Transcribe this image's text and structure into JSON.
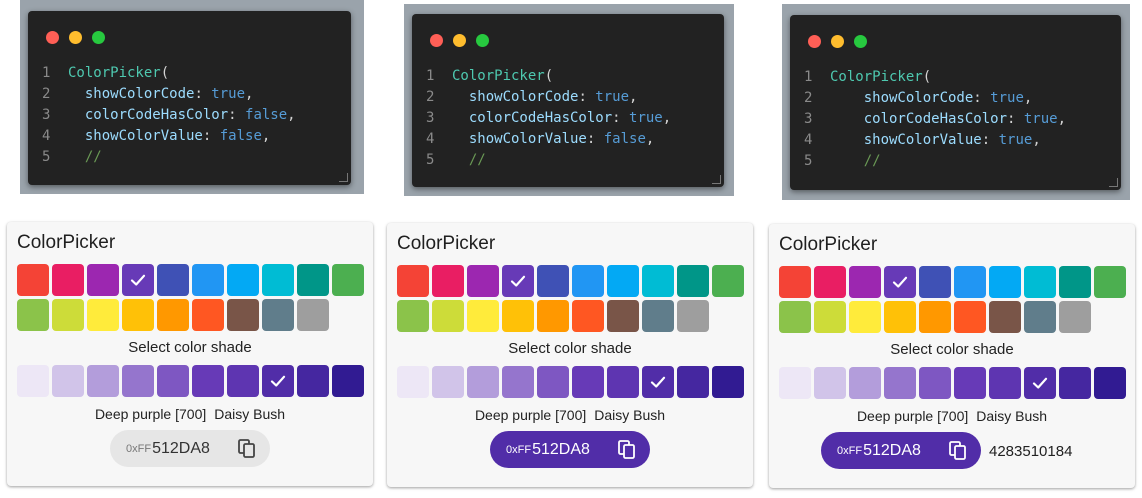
{
  "editors": [
    {
      "lines": [
        [
          "1",
          [
            [
              "cls",
              "ColorPicker"
            ],
            [
              "punct",
              "("
            ]
          ]
        ],
        [
          "2",
          [
            [
              "punct",
              "  "
            ],
            [
              "prop",
              "showColorCode"
            ],
            [
              "punct",
              ": "
            ],
            [
              "kw",
              "true"
            ],
            [
              "punct",
              ","
            ]
          ]
        ],
        [
          "3",
          [
            [
              "punct",
              "  "
            ],
            [
              "prop",
              "colorCodeHasColor"
            ],
            [
              "punct",
              ": "
            ],
            [
              "kw",
              "false"
            ],
            [
              "punct",
              ","
            ]
          ]
        ],
        [
          "4",
          [
            [
              "punct",
              "  "
            ],
            [
              "prop",
              "showColorValue"
            ],
            [
              "punct",
              ": "
            ],
            [
              "kw",
              "false"
            ],
            [
              "punct",
              ","
            ]
          ]
        ],
        [
          "5",
          [
            [
              "punct",
              "  "
            ],
            [
              "cmt",
              "//"
            ]
          ]
        ]
      ]
    },
    {
      "lines": [
        [
          "1",
          [
            [
              "cls",
              "ColorPicker"
            ],
            [
              "punct",
              "("
            ]
          ]
        ],
        [
          "2",
          [
            [
              "punct",
              "  "
            ],
            [
              "prop",
              "showColorCode"
            ],
            [
              "punct",
              ": "
            ],
            [
              "kw",
              "true"
            ],
            [
              "punct",
              ","
            ]
          ]
        ],
        [
          "3",
          [
            [
              "punct",
              "  "
            ],
            [
              "prop",
              "colorCodeHasColor"
            ],
            [
              "punct",
              ": "
            ],
            [
              "kw",
              "true"
            ],
            [
              "punct",
              ","
            ]
          ]
        ],
        [
          "4",
          [
            [
              "punct",
              "  "
            ],
            [
              "prop",
              "showColorValue"
            ],
            [
              "punct",
              ": "
            ],
            [
              "kw",
              "false"
            ],
            [
              "punct",
              ","
            ]
          ]
        ],
        [
          "5",
          [
            [
              "punct",
              "  "
            ],
            [
              "cmt",
              "//"
            ]
          ]
        ]
      ]
    },
    {
      "lines": [
        [
          "1",
          [
            [
              "cls",
              "ColorPicker"
            ],
            [
              "punct",
              "("
            ]
          ]
        ],
        [
          "2",
          [
            [
              "punct",
              "    "
            ],
            [
              "prop",
              "showColorCode"
            ],
            [
              "punct",
              ": "
            ],
            [
              "kw",
              "true"
            ],
            [
              "punct",
              ","
            ]
          ]
        ],
        [
          "3",
          [
            [
              "punct",
              "    "
            ],
            [
              "prop",
              "colorCodeHasColor"
            ],
            [
              "punct",
              ": "
            ],
            [
              "kw",
              "true"
            ],
            [
              "punct",
              ","
            ]
          ]
        ],
        [
          "4",
          [
            [
              "punct",
              "    "
            ],
            [
              "prop",
              "showColorValue"
            ],
            [
              "punct",
              ": "
            ],
            [
              "kw",
              "true"
            ],
            [
              "punct",
              ","
            ]
          ]
        ],
        [
          "5",
          [
            [
              "punct",
              "    "
            ],
            [
              "cmt",
              "//"
            ]
          ]
        ]
      ]
    }
  ],
  "palette": {
    "main_colors": [
      "#F44336",
      "#E91E63",
      "#9C27B0",
      "#673AB7",
      "#3F51B5",
      "#2196F3",
      "#03A9F4",
      "#00BCD4",
      "#009688",
      "#4CAF50",
      "#8BC34A",
      "#CDDC39",
      "#FFEB3B",
      "#FFC107",
      "#FF9800",
      "#FF5722",
      "#795548",
      "#607D8B",
      "#9E9E9E"
    ],
    "selected_main_index": 3,
    "shades": [
      "#EDE7F6",
      "#D1C4E9",
      "#B39DDB",
      "#9575CD",
      "#7E57C2",
      "#673AB7",
      "#5E35B1",
      "#512DA8",
      "#4527A0",
      "#311B92"
    ],
    "selected_shade_index": 7
  },
  "cards": [
    {
      "title": "ColorPicker",
      "shade_label": "Select color shade",
      "color_name": "Deep purple [700]",
      "color_alias": "Daisy Bush",
      "code_prefix": "0xFF",
      "code_hex": "512DA8",
      "code_chip_colored": false,
      "color_value": ""
    },
    {
      "title": "ColorPicker",
      "shade_label": "Select color shade",
      "color_name": "Deep purple [700]",
      "color_alias": "Daisy Bush",
      "code_prefix": "0xFF",
      "code_hex": "512DA8",
      "code_chip_colored": true,
      "color_value": ""
    },
    {
      "title": "ColorPicker",
      "shade_label": "Select color shade",
      "color_name": "Deep purple [700]",
      "color_alias": "Daisy Bush",
      "code_prefix": "0xFF",
      "code_hex": "512DA8",
      "code_chip_colored": true,
      "color_value": "4283510184"
    }
  ],
  "icons": {
    "window_dots": [
      "close-dot",
      "minimize-dot",
      "maximize-dot"
    ],
    "check": "check-icon",
    "copy": "copy-icon"
  },
  "colors": {
    "editor_bg": "#222222",
    "chip_selected": "#512DA8",
    "chip_plain": "#E6E6E6"
  }
}
